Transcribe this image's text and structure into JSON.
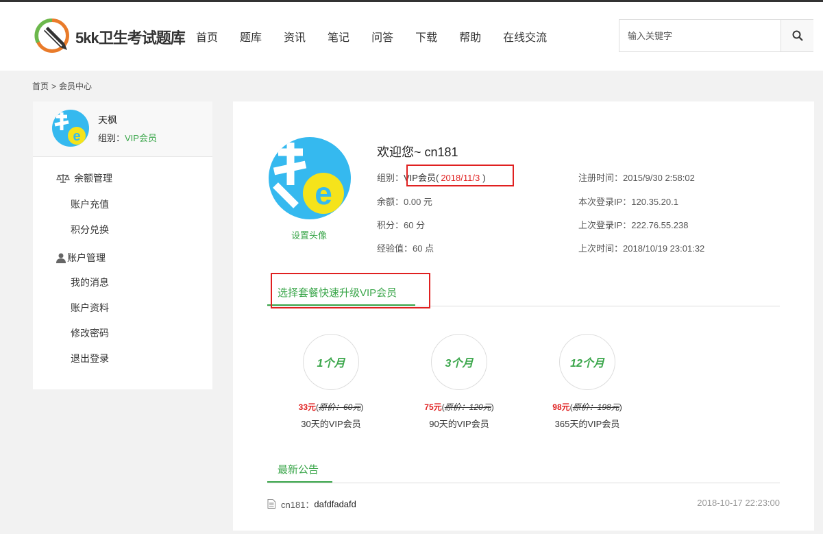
{
  "site": {
    "logo_text": "5kk卫生考试题库"
  },
  "nav": [
    "首页",
    "题库",
    "资讯",
    "笔记",
    "问答",
    "下载",
    "帮助",
    "在线交流"
  ],
  "search": {
    "placeholder": "输入关键字"
  },
  "breadcrumb": {
    "home": "首页",
    "sep": ">",
    "current": "会员中心"
  },
  "sidebar": {
    "username": "天枫",
    "group_label": "组别：",
    "group_value": "VIP会员",
    "sections": [
      {
        "title": "余额管理",
        "icon": "scale-icon",
        "items": [
          "账户充值",
          "积分兑换"
        ]
      },
      {
        "title": "账户管理",
        "icon": "user-icon",
        "items": [
          "我的消息",
          "账户资料",
          "修改密码",
          "退出登录"
        ]
      }
    ]
  },
  "profile": {
    "welcome": "欢迎您~ cn181",
    "set_avatar": "设置头像",
    "group_label": "组别：",
    "group_value": "VIP会员(",
    "group_expire": "2018/11/3",
    "group_close": ")",
    "balance": "余额：0.00 元",
    "points": "积分：60 分",
    "exp": "经验值：60 点",
    "reg_time": "注册时间：2015/9/30 2:58:02",
    "login_ip": "本次登录IP：120.35.20.1",
    "last_ip": "上次登录IP：222.76.55.238",
    "last_time": "上次时间：2018/10/19 23:01:32"
  },
  "upgrade": {
    "tab_label": "选择套餐快速升级VIP会员",
    "plans": [
      {
        "name": "1个月",
        "price": "33元",
        "orig": "原价：60元",
        "desc": "30天的VIP会员"
      },
      {
        "name": "3个月",
        "price": "75元",
        "orig": "原价：120元",
        "desc": "90天的VIP会员"
      },
      {
        "name": "12个月",
        "price": "98元",
        "orig": "原价：198元",
        "desc": "365天的VIP会员"
      }
    ]
  },
  "notice": {
    "tab_label": "最新公告",
    "items": [
      {
        "prefix": "cn181：",
        "text": "dafdfadafd",
        "date": "2018-10-17 22:23:00"
      }
    ]
  },
  "colors": {
    "accent": "#3aa64a",
    "highlight": "#e02020"
  }
}
